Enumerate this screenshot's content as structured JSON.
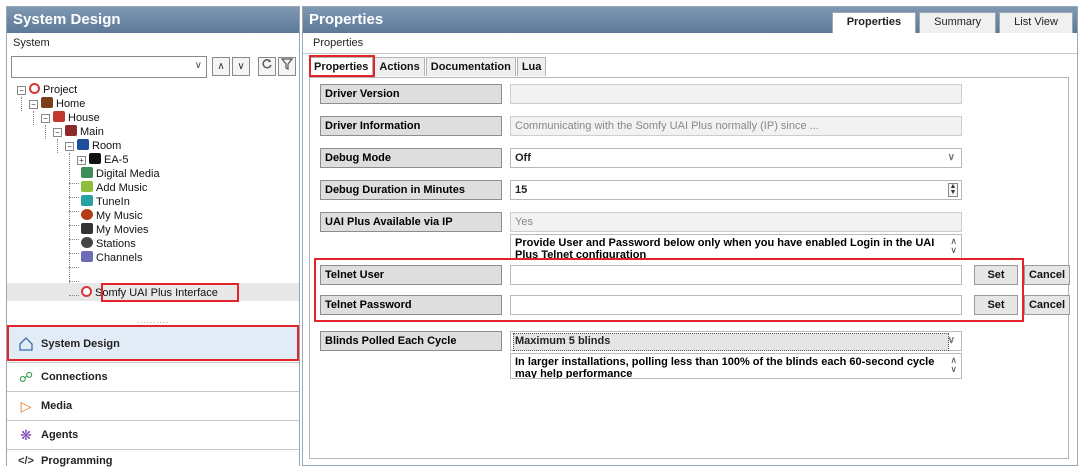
{
  "left_panel": {
    "title": "System Design",
    "subtitle": "System",
    "tree": [
      {
        "label": "Project",
        "icon": "project-icon"
      },
      {
        "label": "Home",
        "icon": "home-icon"
      },
      {
        "label": "House",
        "icon": "house-icon"
      },
      {
        "label": "Main",
        "icon": "floor-icon"
      },
      {
        "label": "Room",
        "icon": "room-icon"
      },
      {
        "label": "EA-5",
        "icon": "controller-icon"
      },
      {
        "label": "Digital Media",
        "icon": "digital-media-icon"
      },
      {
        "label": "Add Music",
        "icon": "add-music-icon"
      },
      {
        "label": "TuneIn",
        "icon": "tunein-icon"
      },
      {
        "label": "My Music",
        "icon": "my-music-icon"
      },
      {
        "label": "My Movies",
        "icon": "my-movies-icon"
      },
      {
        "label": "Stations",
        "icon": "stations-icon"
      },
      {
        "label": "Channels",
        "icon": "channels-icon"
      },
      {
        "label": "Somfy UAI Plus Interface",
        "icon": "driver-icon"
      }
    ],
    "nav": [
      {
        "label": "System Design",
        "icon": "house-outline-icon"
      },
      {
        "label": "Connections",
        "icon": "connections-icon"
      },
      {
        "label": "Media",
        "icon": "play-icon"
      },
      {
        "label": "Agents",
        "icon": "agents-icon"
      },
      {
        "label": "Programming",
        "icon": "code-icon"
      }
    ]
  },
  "right_panel": {
    "title": "Properties",
    "view_tabs": [
      "Properties",
      "Summary",
      "List View"
    ],
    "subtitle": "Properties",
    "inner_tabs": [
      "Properties",
      "Actions",
      "Documentation",
      "Lua"
    ],
    "properties": {
      "driver_version": {
        "label": "Driver Version",
        "value": ""
      },
      "driver_information": {
        "label": "Driver Information",
        "value": "Communicating with the Somfy UAI Plus normally (IP) since ..."
      },
      "debug_mode": {
        "label": "Debug Mode",
        "value": "Off"
      },
      "debug_duration": {
        "label": "Debug Duration in Minutes",
        "value": "15"
      },
      "uai_available": {
        "label": "UAI Plus Available via IP",
        "value": "Yes",
        "description": "Provide User and Password below only when you have enabled Login in the UAI Plus Telnet configuration"
      },
      "telnet_user": {
        "label": "Telnet User",
        "value": "",
        "set_label": "Set",
        "cancel_label": "Cancel"
      },
      "telnet_password": {
        "label": "Telnet Password",
        "value": "",
        "set_label": "Set",
        "cancel_label": "Cancel"
      },
      "blinds_polled": {
        "label": "Blinds Polled Each Cycle",
        "value": "Maximum 5 blinds",
        "description": "In larger installations, polling less than 100% of the blinds each 60-second cycle may help performance"
      }
    }
  },
  "colors": {
    "title_bar": "#6d88a5",
    "highlight_red": "#e3242b",
    "nav_active": "#e1ecf7"
  }
}
